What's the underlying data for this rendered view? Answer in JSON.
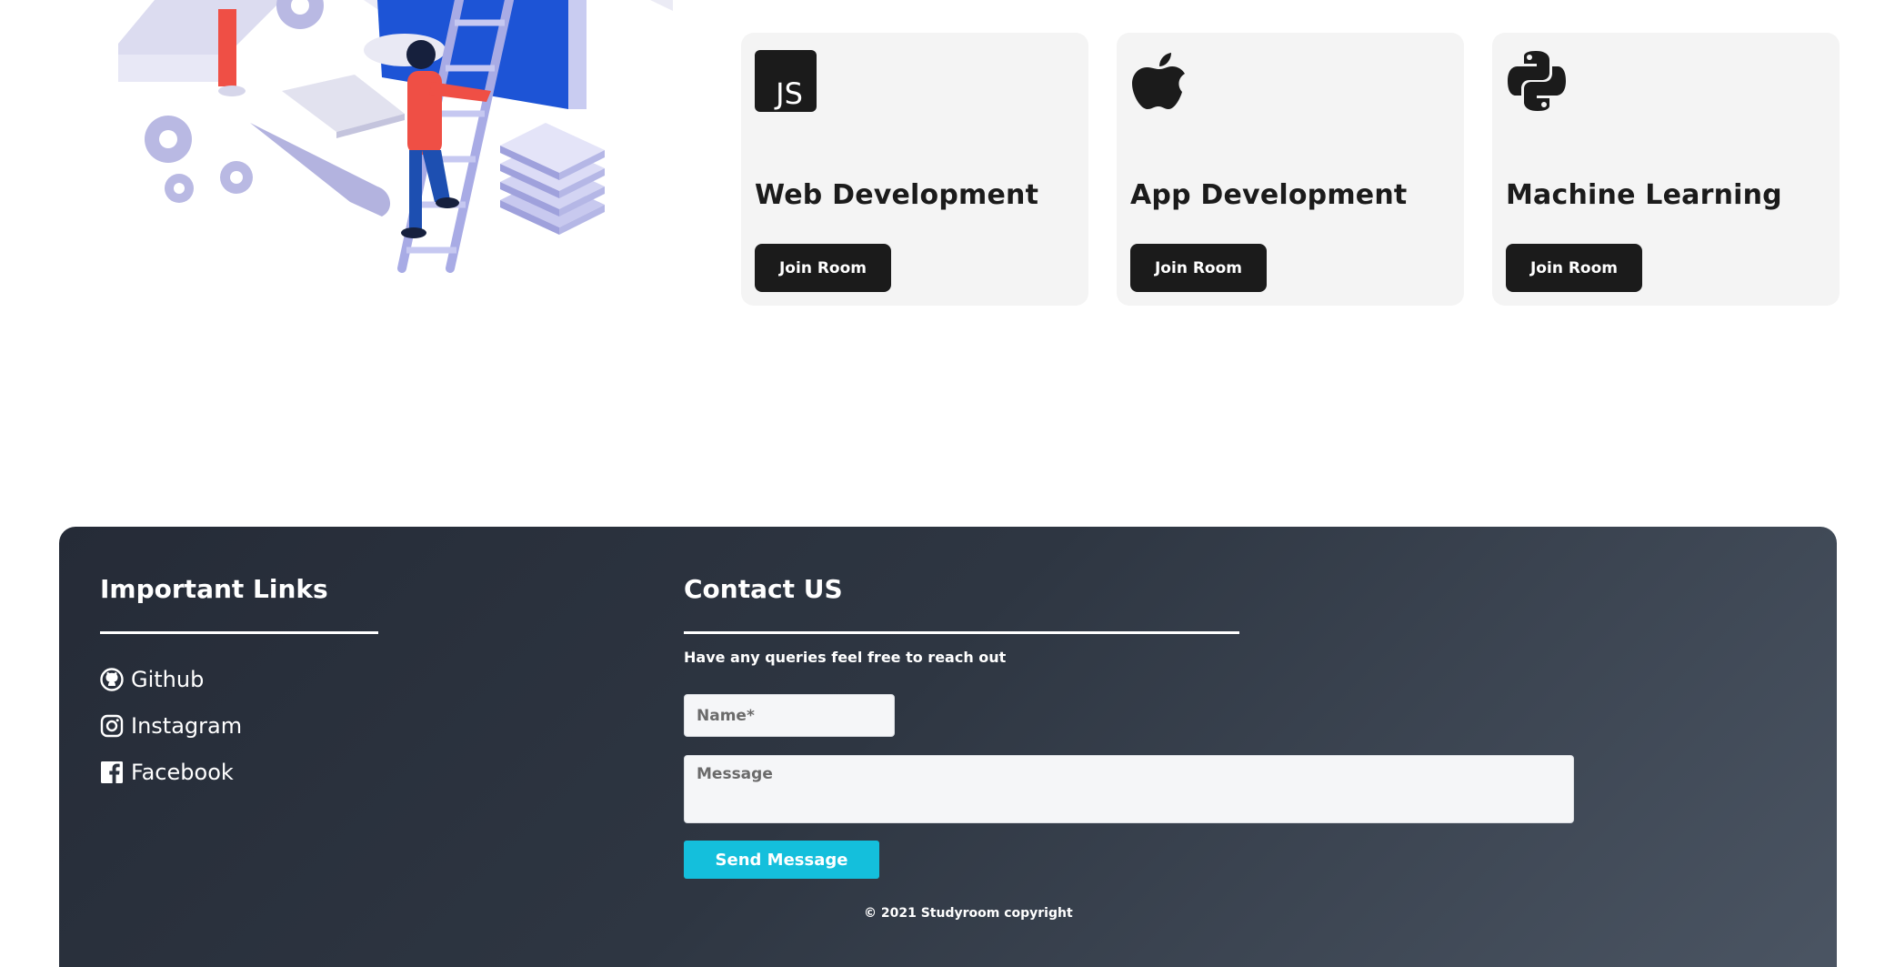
{
  "colors": {
    "card_bg": "#f4f4f4",
    "button_dark": "#1b1b1b",
    "accent": "#14bfdc",
    "footer_gradient_start": "#252b37",
    "footer_gradient_end": "#4b5563"
  },
  "illustration": {
    "icon": "developer-ladder-illustration"
  },
  "cards": [
    {
      "icon": "javascript-icon",
      "icon_text": "JS",
      "title": "Web Development",
      "button_label": "Join Room"
    },
    {
      "icon": "apple-icon",
      "title": "App Development",
      "button_label": "Join Room"
    },
    {
      "icon": "python-icon",
      "title": "Machine Learning",
      "button_label": "Join Room"
    }
  ],
  "footer": {
    "links": {
      "heading": "Important Links",
      "items": [
        {
          "icon": "github-icon",
          "label": "Github"
        },
        {
          "icon": "instagram-icon",
          "label": "Instagram"
        },
        {
          "icon": "facebook-icon",
          "label": "Facebook"
        }
      ]
    },
    "contact": {
      "heading": "Contact US",
      "subtitle": "Have any queries feel free to reach out",
      "name_placeholder": "Name*",
      "message_placeholder": "Message",
      "send_label": "Send Message"
    },
    "copyright": "© 2021 Studyroom copyright"
  }
}
